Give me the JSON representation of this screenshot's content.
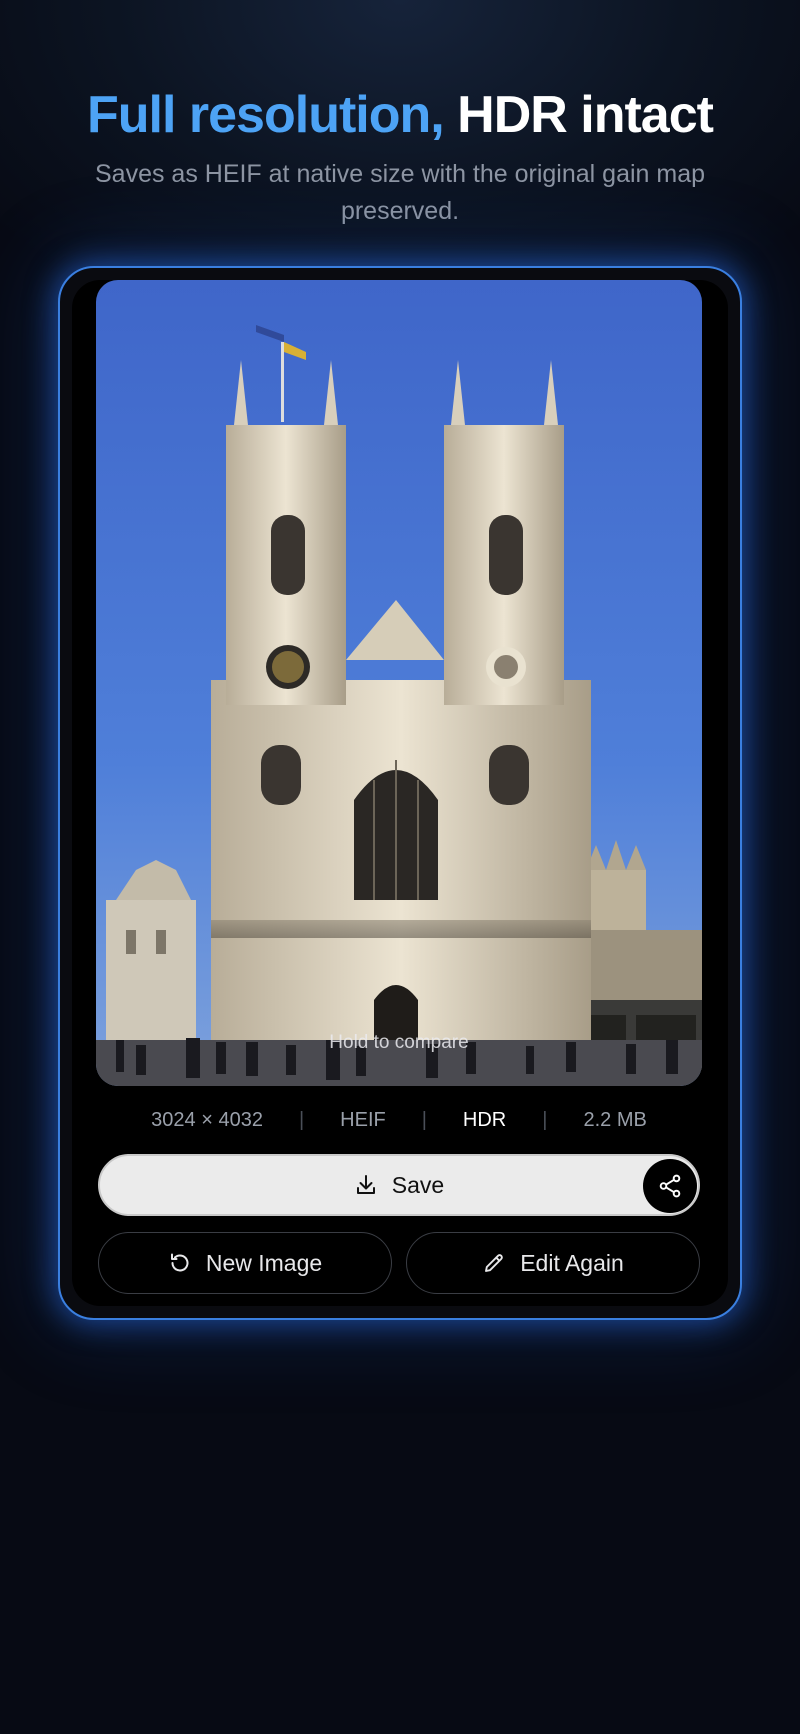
{
  "header": {
    "title_accent": "Full resolution,",
    "title_rest": " HDR intact",
    "subtitle": "Saves as HEIF at native size with the original gain map preserved."
  },
  "preview": {
    "hint": "Hold to compare"
  },
  "meta": {
    "dimensions": "3024 × 4032",
    "format": "HEIF",
    "dynamic_range": "HDR",
    "file_size": "2.2 MB"
  },
  "actions": {
    "save_label": "Save",
    "new_image_label": "New Image",
    "edit_again_label": "Edit Again"
  },
  "icons": {
    "save": "download-icon",
    "share": "share-icon",
    "new_image": "refresh-icon",
    "edit_again": "pencil-icon"
  },
  "colors": {
    "accent": "#4da3f5",
    "card_border": "#3a7fe0",
    "save_button_bg": "#ebebeb",
    "background": "#05070f"
  }
}
